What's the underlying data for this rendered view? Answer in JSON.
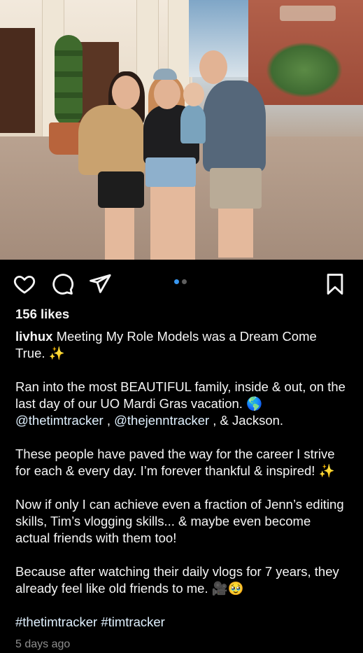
{
  "post": {
    "likes": "156 likes",
    "username": "livhux",
    "caption": {
      "p1": " Meeting My Role Models was a Dream Come True. ✨",
      "p2": "Ran into the most BEAUTIFUL family, inside & out, on the last day of our UO Mardi Gras vacation. 🌎",
      "mention1": "@thetimtracker",
      "sep1": " , ",
      "mention2": "@thejenntracker",
      "p2_end": " , & Jackson.",
      "p3": "These people have paved the way for the career I strive for each & every day. I’m forever thankful & inspired! ✨",
      "p4": "Now if only I can achieve even a fraction of Jenn’s editing skills, Tim’s vlogging skills... & maybe even become actual friends with them too!",
      "p5": "Because after watching their daily vlogs for 7 years, they already feel like old friends to me. 🎥🥹"
    },
    "hashtags": "#thetimtracker #timtracker",
    "timestamp": "5 days ago",
    "carousel": {
      "total": 2,
      "active": 1
    }
  },
  "icons": {
    "like": "heart-icon",
    "comment": "comment-icon",
    "share": "paper-plane-icon",
    "save": "bookmark-icon"
  },
  "colors": {
    "background": "#000000",
    "text": "#f5f5f5",
    "active_dot": "#3897f0",
    "muted": "#8e8e8e"
  }
}
